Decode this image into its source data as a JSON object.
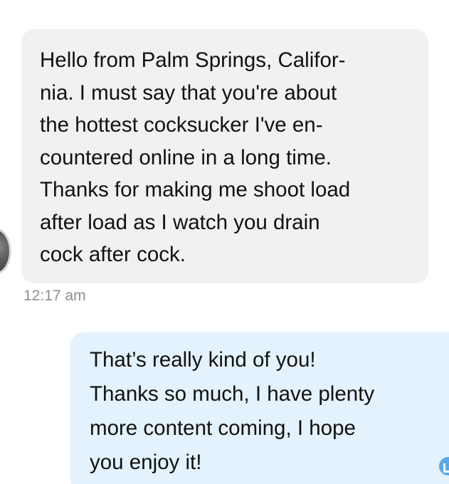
{
  "conversation": {
    "incoming": {
      "text": "Hello from Palm Springs, Califor-\nnia. I must say that you're about\nthe hottest cocksucker I've en-\ncountered online in a long time.\nThanks for making me shoot load\nafter load as I watch you drain\ncock after cock.",
      "timestamp": "12:17 am",
      "avatar_icon": "avatar"
    },
    "outgoing": {
      "text": "That’s really kind of you!\nThanks so much, I have plenty\nmore content coming, I hope\nyou enjoy it!",
      "read_receipt_icon": "read-receipt-icon"
    }
  },
  "colors": {
    "incoming_bubble": "#f0f1f3",
    "outgoing_bubble": "#e3f2fc",
    "timestamp": "#8e8e8e",
    "text": "#111111",
    "receipt": "#5aa7e6"
  }
}
